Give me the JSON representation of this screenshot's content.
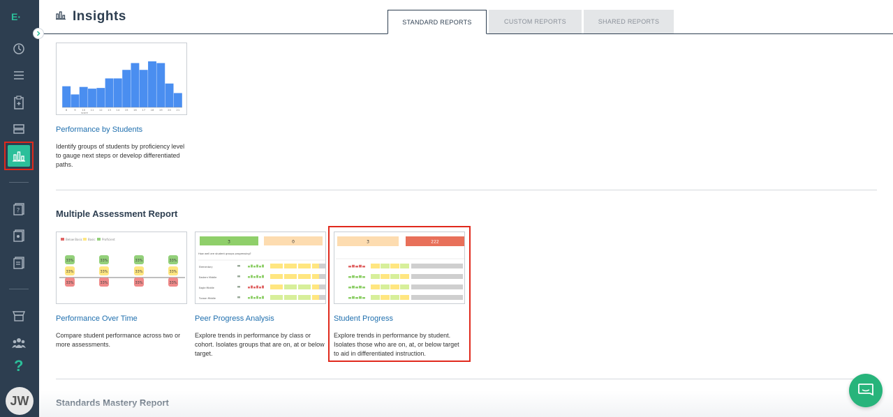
{
  "app": {
    "logo": "E",
    "title": "Insights"
  },
  "tabs": [
    {
      "label": "STANDARD REPORTS",
      "active": true
    },
    {
      "label": "CUSTOM REPORTS",
      "active": false
    },
    {
      "label": "SHARED REPORTS",
      "active": false
    }
  ],
  "sidebar": {
    "items": [
      {
        "icon": "dashboard-icon"
      },
      {
        "icon": "list-icon"
      },
      {
        "icon": "clipboard-icon"
      },
      {
        "icon": "database-icon"
      },
      {
        "icon": "insights-chart-icon",
        "active": true
      },
      {
        "icon": "question-bank-icon"
      },
      {
        "icon": "assessment-icon"
      },
      {
        "icon": "document-icon"
      },
      {
        "icon": "store-icon"
      },
      {
        "icon": "groups-icon"
      },
      {
        "icon": "help-icon"
      }
    ],
    "avatar_initials": "JW",
    "accent": "#2bbf9a"
  },
  "single_report": {
    "card": {
      "title": "Performance by Students",
      "description": "Identify groups of students by proficiency level to gauge next steps or develop differentiated paths.",
      "x_ticks": [
        "8",
        "9",
        "10",
        "11",
        "12",
        "13",
        "14",
        "15",
        "16",
        "17",
        "18",
        "19",
        "20",
        "21"
      ],
      "x_label": "score",
      "bar_levels": [
        0.62,
        0.38,
        0.6,
        0.55,
        0.57,
        0.85,
        0.85,
        1.1,
        1.3,
        1.1,
        1.35,
        1.3,
        0.7,
        0.42
      ]
    }
  },
  "multiple_section": {
    "title": "Multiple Assessment Report",
    "cards": [
      {
        "title": "Performance Over Time",
        "description": "Compare student performance across two or more assessments.",
        "legend": [
          "Below Basic",
          "Basic",
          "Proficient"
        ],
        "cells": [
          "33%",
          "33%",
          "33%"
        ]
      },
      {
        "title": "Peer Progress Analysis",
        "description": "Explore trends in performance by class or cohort. Isolates groups that are on, at or below target.",
        "top_left": "3",
        "top_right": "0",
        "question": "How well are student groups progressing?",
        "rows": [
          "Elementary",
          "Eastern Middle",
          "Eagle Middle",
          "Tucson Middle"
        ]
      },
      {
        "title": "Student Progress",
        "description": "Explore trends in performance by student. Isolates those who are on, at, or below target to aid in differentiated instruction.",
        "top_left": "3",
        "top_right": "222"
      }
    ]
  },
  "standards_section": {
    "title": "Standards Mastery Report"
  },
  "colors": {
    "bar": "#4a8ef0",
    "highlight": "#e0291c",
    "link": "#1f6fae",
    "chat": "#27b47b"
  }
}
